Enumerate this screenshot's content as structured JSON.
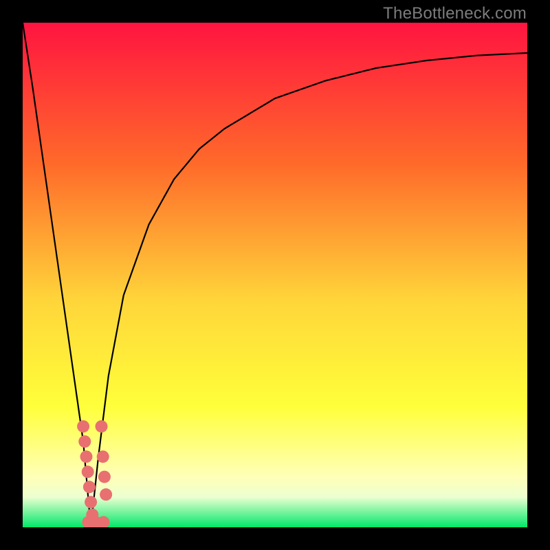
{
  "watermark": "TheBottleneck.com",
  "colors": {
    "frame": "#000000",
    "gradient_top": "#ff1440",
    "gradient_mid1": "#ff7a2a",
    "gradient_mid2": "#ffd53a",
    "gradient_mid3": "#ffff3a",
    "gradient_pale": "#ffffc8",
    "gradient_bottom": "#00e86a",
    "curve": "#000000",
    "marker": "#e87070"
  },
  "chart_data": {
    "type": "line",
    "title": "",
    "xlabel": "",
    "ylabel": "",
    "xlim": [
      0,
      100
    ],
    "ylim": [
      0,
      100
    ],
    "series": [
      {
        "name": "bottleneck-curve",
        "x": [
          0,
          2,
          4,
          6,
          8,
          10,
          12,
          13.5,
          15,
          17,
          20,
          25,
          30,
          35,
          40,
          50,
          60,
          70,
          80,
          90,
          100
        ],
        "values": [
          100,
          87,
          73,
          59,
          45,
          31,
          17,
          0,
          14,
          30,
          46,
          60,
          69,
          75,
          79,
          85,
          88.5,
          91,
          92.5,
          93.5,
          94
        ]
      }
    ],
    "markers": {
      "name": "highlight-cluster",
      "points": [
        {
          "x": 12.0,
          "y": 20.0
        },
        {
          "x": 12.3,
          "y": 17.0
        },
        {
          "x": 12.6,
          "y": 14.0
        },
        {
          "x": 12.9,
          "y": 11.0
        },
        {
          "x": 13.2,
          "y": 8.0
        },
        {
          "x": 13.5,
          "y": 5.0
        },
        {
          "x": 13.8,
          "y": 2.5
        },
        {
          "x": 13.0,
          "y": 1.0
        },
        {
          "x": 14.5,
          "y": 1.0
        },
        {
          "x": 16.0,
          "y": 1.0
        },
        {
          "x": 15.6,
          "y": 20.0
        },
        {
          "x": 15.9,
          "y": 14.0
        },
        {
          "x": 16.2,
          "y": 10.0
        },
        {
          "x": 16.5,
          "y": 6.5
        }
      ]
    },
    "valley_x": 13.5
  }
}
